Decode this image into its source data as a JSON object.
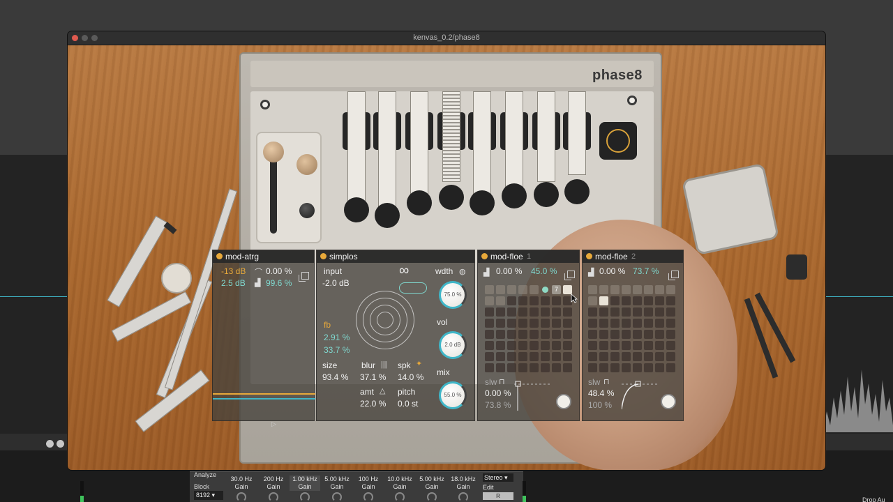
{
  "window": {
    "title": "kenvas_0.2/phase8"
  },
  "device": {
    "brand": "phase8"
  },
  "panels": {
    "atrg": {
      "title": "mod-atrg",
      "val_a1": "-13 dB",
      "val_a2": "0.00 %",
      "val_b1": "2.5 dB",
      "val_b2": "99.6 %"
    },
    "simplos": {
      "title": "simplos",
      "input_label": "input",
      "input_value": "-2.0 dB",
      "wdth_label": "wdth",
      "wdth_value": "75.0 %",
      "fb_label": "fb",
      "fb_value1": "2.91 %",
      "fb_value2": "33.7 %",
      "vol_label": "vol",
      "vol_value": "2.0 dB",
      "size_label": "size",
      "size_value": "93.4 %",
      "blur_label": "blur",
      "blur_value": "37.1 %",
      "spk_label": "spk",
      "spk_value": "14.0 %",
      "mix_label": "mix",
      "mix_value": "55.0 %",
      "amt_label": "amt",
      "amt_value": "22.0 %",
      "pitch_label": "pitch",
      "pitch_value": "0.0 st"
    },
    "floe1": {
      "title": "mod-floe",
      "num": "1",
      "val1": "0.00 %",
      "val2": "45.0 %",
      "sev_label": "7",
      "slw_label": "slw",
      "slw_value": "0.00 %",
      "slw_value2": "73.8 %"
    },
    "floe2": {
      "title": "mod-floe",
      "num": "2",
      "val1": "0.00 %",
      "val2": "73.7 %",
      "slw_label": "slw",
      "slw_value": "48.4 %",
      "slw_value2": "100 %"
    }
  },
  "eq": {
    "analyze_label": "Analyze",
    "block_label": "Block",
    "block_value": "8192",
    "bands": [
      {
        "freq": "30.0 Hz",
        "gain": "Gain"
      },
      {
        "freq": "200 Hz",
        "gain": "Gain"
      },
      {
        "freq": "1.00 kHz",
        "gain": "Gain"
      },
      {
        "freq": "5.00 kHz",
        "gain": "Gain"
      },
      {
        "freq": "100 Hz",
        "gain": "Gain"
      },
      {
        "freq": "10.0 kHz",
        "gain": "Gain"
      },
      {
        "freq": "5.00 kHz",
        "gain": "Gain"
      },
      {
        "freq": "18.0 kHz",
        "gain": "Gain"
      }
    ],
    "stereo_label": "Stereo",
    "edit_label": "Edit",
    "r_label": "R"
  },
  "corner_text": "Drop Au",
  "colors": {
    "accent": "#3fb6c8",
    "orange": "#e8a93a",
    "window_bg": "#1e1e1e"
  }
}
